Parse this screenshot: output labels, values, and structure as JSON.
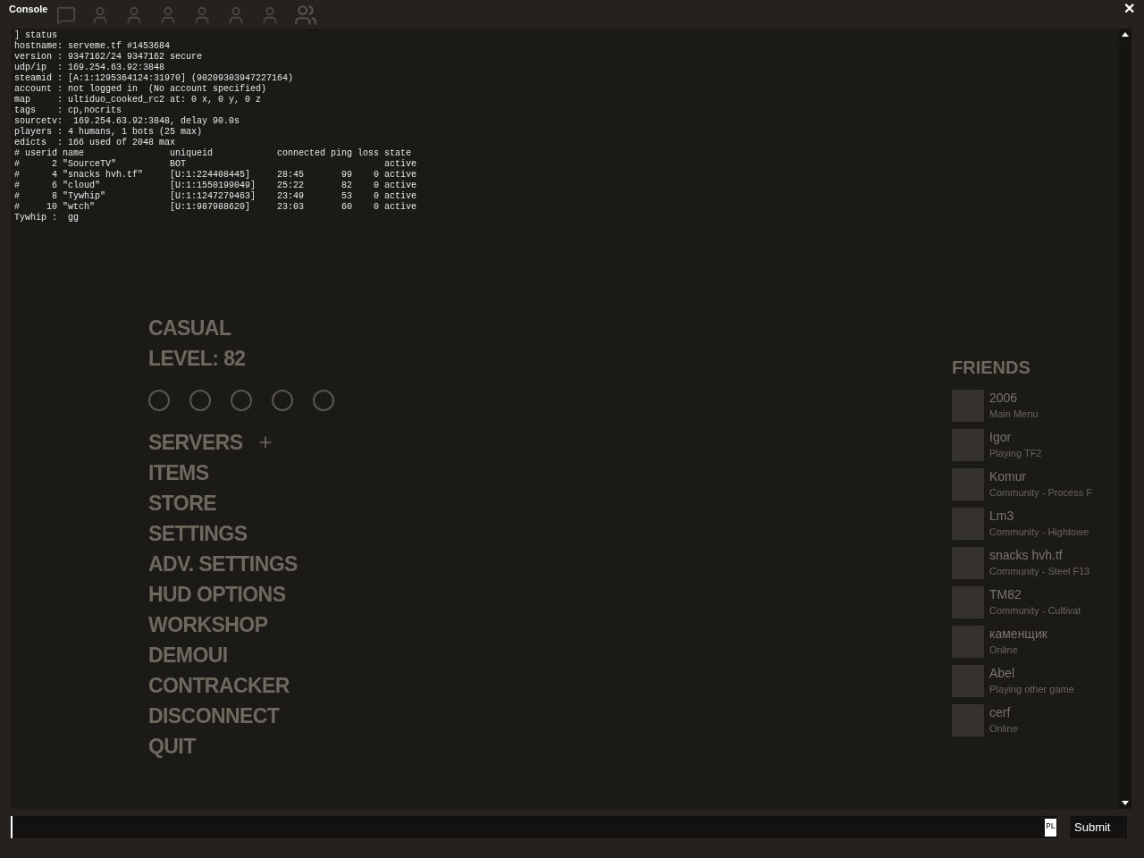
{
  "window": {
    "title": "Console",
    "close": "✕"
  },
  "background": {
    "mode": "CASUAL",
    "level": "LEVEL: 82",
    "menu": [
      {
        "label": "SERVERS",
        "kind": "plus"
      },
      {
        "label": "ITEMS",
        "kind": "plain"
      },
      {
        "label": "STORE",
        "kind": "plain"
      },
      {
        "label": "SETTINGS",
        "kind": "plain"
      },
      {
        "label": "ADV. SETTINGS",
        "kind": "plain"
      },
      {
        "label": "HUD OPTIONS",
        "kind": "plain"
      },
      {
        "label": "WORKSHOP",
        "kind": "plain"
      },
      {
        "label": "DEMOUI",
        "kind": "plain"
      },
      {
        "label": "CONTRACKER",
        "kind": "plain"
      },
      {
        "label": "DISCONNECT",
        "kind": "plain"
      },
      {
        "label": "QUIT",
        "kind": "plain"
      }
    ],
    "friends_title": "FRIENDS",
    "friends": [
      {
        "name": "2006",
        "status": "Main Menu"
      },
      {
        "name": "Igor",
        "status": "Playing TF2"
      },
      {
        "name": "Komur",
        "status": "Community - Process F"
      },
      {
        "name": "Lm3",
        "status": "Community - Hightowe"
      },
      {
        "name": "snacks hvh.tf",
        "status": "Community - Steel F13"
      },
      {
        "name": "TM82",
        "status": "Community - Cultivat"
      },
      {
        "name": "каменщик",
        "status": "Online"
      },
      {
        "name": "Abel",
        "status": "Playing other game"
      },
      {
        "name": "cerf",
        "status": "Online"
      }
    ]
  },
  "console": {
    "lines": [
      "] status",
      "hostname: serveme.tf #1453684",
      "version : 9347162/24 9347162 secure",
      "udp/ip  : 169.254.63.92:3848",
      "steamid : [A:1:1295364124:31970] (90209303947227164)",
      "account : not logged in  (No account specified)",
      "map     : ultiduo_cooked_rc2 at: 0 x, 0 y, 0 z",
      "tags    : cp,nocrits",
      "sourcetv:  169.254.63.92:3848, delay 90.0s",
      "players : 4 humans, 1 bots (25 max)",
      "edicts  : 166 used of 2048 max",
      "# userid name                uniqueid            connected ping loss state",
      "#      2 \"SourceTV\"          BOT                                     active",
      "#      4 \"snacks hvh.tf\"     [U:1:224408445]     28:45       99    0 active",
      "#      6 \"cloud\"             [U:1:1550199049]    25:22       82    0 active",
      "#      8 \"Tywhip\"            [U:1:1247279463]    23:49       53    0 active",
      "#     10 \"wtch\"              [U:1:987988620]     23:03       60    0 active",
      "Tywhip :  gg"
    ]
  },
  "input": {
    "language": "PL",
    "submit": "Submit"
  }
}
